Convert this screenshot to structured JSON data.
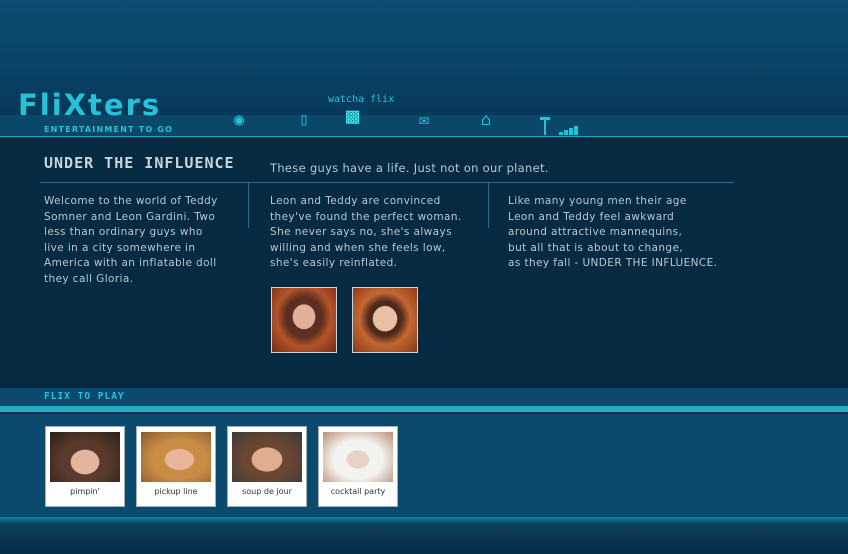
{
  "header": {
    "logo_text": "FliXters",
    "tagline": "ENTERTAINMENT TO GO",
    "watcha_label": "watcha flix"
  },
  "nav": {
    "icons": [
      "chat-icon",
      "phone-icon",
      "camera-icon",
      "mail-icon",
      "home-icon",
      "signal-icon"
    ],
    "active": "camera-icon"
  },
  "feature": {
    "title": "UNDER THE INFLUENCE",
    "subtitle": "These guys have a life.  Just not on our planet.",
    "col1": "Welcome to the world of Teddy\nSomner and Leon Gardini. Two\nless than ordinary guys who\nlive in a city somewhere in\nAmerica with an inflatable doll\nthey call Gloria.",
    "col2": "Leon and Teddy are convinced\nthey've found the perfect woman.\nShe never says no, she's always\nwilling and when she feels low,\nshe's easily reinflated.",
    "col3": "Like many young men their age\nLeon and Teddy feel awkward\naround attractive mannequins,\nbut all that is about to change,\nas they fall - UNDER THE INFLUENCE."
  },
  "flix": {
    "label": "FLIX TO PLAY",
    "items": [
      {
        "caption": "pimpin'"
      },
      {
        "caption": "pickup line"
      },
      {
        "caption": "soup de jour"
      },
      {
        "caption": "cocktail party"
      }
    ]
  },
  "colors": {
    "accent": "#25c3d9",
    "background": "#062a42",
    "text": "#b9c8d1"
  }
}
